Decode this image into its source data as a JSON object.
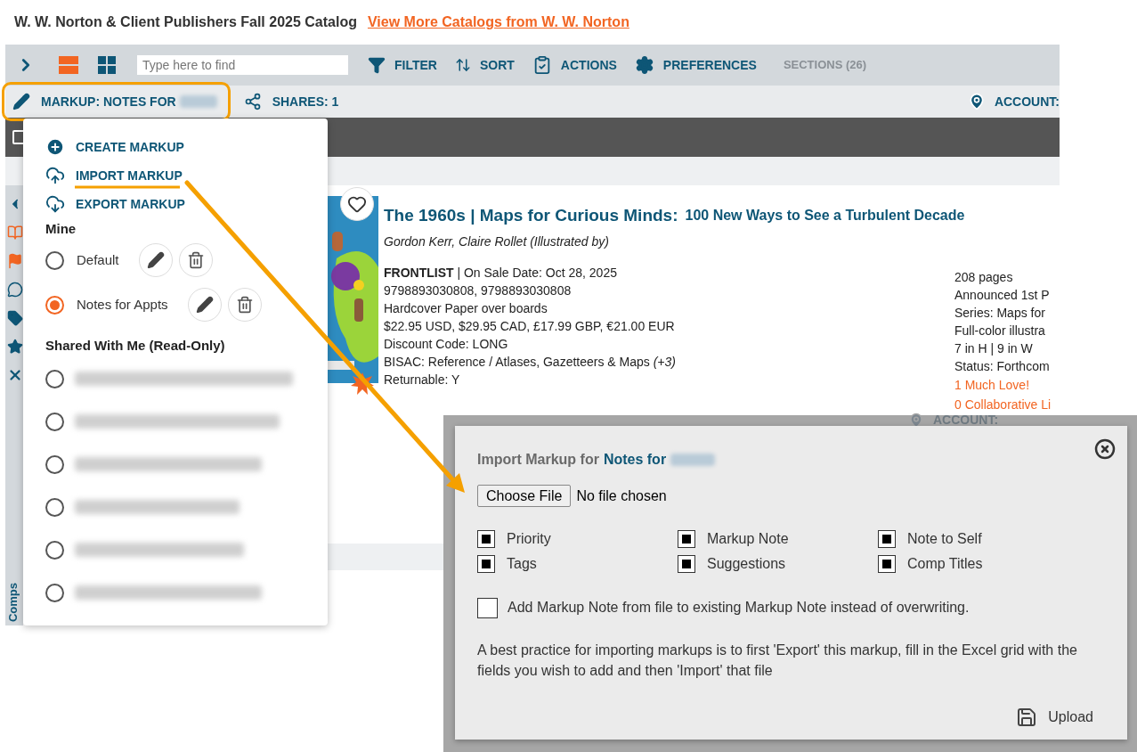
{
  "header": {
    "title": "W. W. Norton & Client Publishers Fall 2025 Catalog",
    "link": "View More Catalogs from W. W. Norton"
  },
  "toolbar": {
    "search_placeholder": "Type here to find",
    "view_modes": [
      {
        "kind": "list",
        "selected": true
      },
      {
        "kind": "grid",
        "selected": false
      }
    ],
    "actions": [
      {
        "kind": "filter",
        "label": "FILTER"
      },
      {
        "kind": "sort",
        "label": "SORT"
      },
      {
        "kind": "actions",
        "label": "ACTIONS"
      },
      {
        "kind": "preferences",
        "label": "PREFERENCES"
      }
    ],
    "sections": {
      "label": "SECTIONS (26)",
      "disabled": true
    }
  },
  "markup_bar": {
    "markup_label": "MARKUP: NOTES FOR",
    "shares_label": "SHARES: 1",
    "account_label": "ACCOUNT:"
  },
  "markup_menu": {
    "actions": [
      {
        "kind": "create",
        "label": "CREATE MARKUP"
      },
      {
        "kind": "import",
        "label": "IMPORT MARKUP"
      },
      {
        "kind": "export",
        "label": "EXPORT MARKUP"
      }
    ],
    "mine_heading": "Mine",
    "mine": [
      {
        "name": "Default",
        "selected": false
      },
      {
        "name": "Notes for Appts",
        "selected": true
      }
    ],
    "shared_heading": "Shared With Me (Read-Only)",
    "shared": [
      {
        "selected": false
      },
      {
        "selected": false
      },
      {
        "selected": false
      },
      {
        "selected": false
      },
      {
        "selected": false
      },
      {
        "selected": false
      }
    ]
  },
  "book": {
    "title": "The 1960s | Maps for Curious Minds:",
    "subtitle": "100 New Ways to See a Turbulent Decade",
    "authors": "Gordon Kerr, Claire Rollet (Illustrated by)",
    "details": [
      "**FRONTLIST** | On Sale Date: Oct 28, 2025",
      "9798893030808, 9798893030808",
      "Hardcover Paper over boards",
      "$22.95 USD, $29.95 CAD, £17.99 GBP, €21.00 EUR",
      "Discount Code: LONG",
      "BISAC: Reference / Atlases, Gazetteers & Maps *(+3)*",
      "Returnable: Y"
    ],
    "facts": [
      {
        "kind": "text",
        "text": "208 pages"
      },
      {
        "kind": "text",
        "text": "Announced 1st P"
      },
      {
        "kind": "text",
        "text": "Series: Maps for"
      },
      {
        "kind": "text",
        "text": "Full-color illustra"
      },
      {
        "kind": "text",
        "text": "7 in H | 9 in W"
      },
      {
        "kind": "text",
        "text": "Status: Forthcom"
      },
      {
        "kind": "link",
        "text": "1 Much Love!"
      },
      {
        "kind": "link",
        "text": "0 Collaborative Li"
      }
    ]
  },
  "select_all": {
    "checked": false
  },
  "sidebar_tab": "Comps",
  "lower_account_label": "ACCOUNT:",
  "dialog": {
    "title_prefix": "Import Markup for",
    "title_target": "Notes for",
    "file_button": "Choose File",
    "file_status": "No file chosen",
    "fields": [
      {
        "label": "Priority",
        "checked": true
      },
      {
        "label": "Markup Note",
        "checked": true
      },
      {
        "label": "Note to Self",
        "checked": true
      },
      {
        "label": "Tags",
        "checked": true
      },
      {
        "label": "Suggestions",
        "checked": true
      },
      {
        "label": "Comp Titles",
        "checked": true
      }
    ],
    "append_option": {
      "label": "Add Markup Note from file to existing Markup Note instead of overwriting.",
      "checked": false
    },
    "hint": "A best practice for importing markups is to first 'Export' this markup, fill in the Excel grid with the fields you wish to add and then 'Import' that file",
    "upload": "Upload"
  }
}
